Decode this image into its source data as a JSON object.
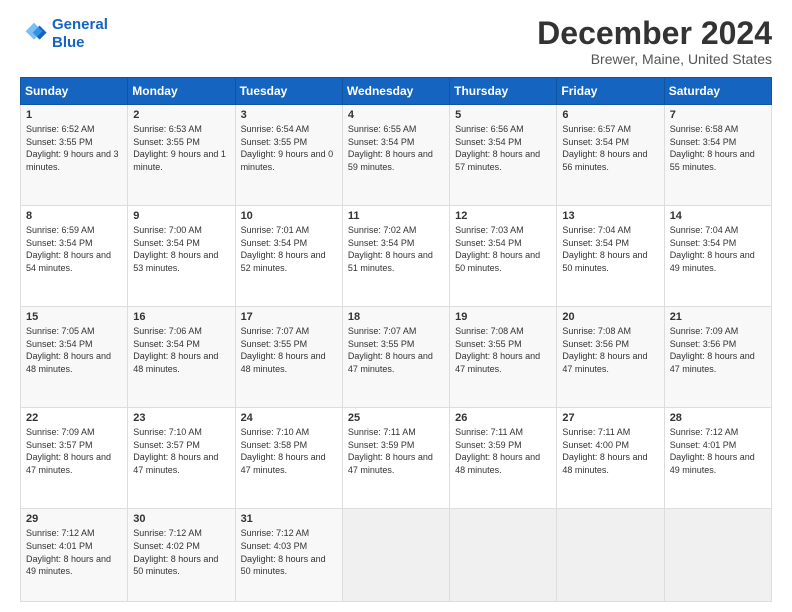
{
  "header": {
    "logo_line1": "General",
    "logo_line2": "Blue",
    "title": "December 2024",
    "subtitle": "Brewer, Maine, United States"
  },
  "days_of_week": [
    "Sunday",
    "Monday",
    "Tuesday",
    "Wednesday",
    "Thursday",
    "Friday",
    "Saturday"
  ],
  "weeks": [
    [
      {
        "day": "1",
        "sunrise": "6:52 AM",
        "sunset": "3:55 PM",
        "daylight": "9 hours and 3 minutes."
      },
      {
        "day": "2",
        "sunrise": "6:53 AM",
        "sunset": "3:55 PM",
        "daylight": "9 hours and 1 minute."
      },
      {
        "day": "3",
        "sunrise": "6:54 AM",
        "sunset": "3:55 PM",
        "daylight": "9 hours and 0 minutes."
      },
      {
        "day": "4",
        "sunrise": "6:55 AM",
        "sunset": "3:54 PM",
        "daylight": "8 hours and 59 minutes."
      },
      {
        "day": "5",
        "sunrise": "6:56 AM",
        "sunset": "3:54 PM",
        "daylight": "8 hours and 57 minutes."
      },
      {
        "day": "6",
        "sunrise": "6:57 AM",
        "sunset": "3:54 PM",
        "daylight": "8 hours and 56 minutes."
      },
      {
        "day": "7",
        "sunrise": "6:58 AM",
        "sunset": "3:54 PM",
        "daylight": "8 hours and 55 minutes."
      }
    ],
    [
      {
        "day": "8",
        "sunrise": "6:59 AM",
        "sunset": "3:54 PM",
        "daylight": "8 hours and 54 minutes."
      },
      {
        "day": "9",
        "sunrise": "7:00 AM",
        "sunset": "3:54 PM",
        "daylight": "8 hours and 53 minutes."
      },
      {
        "day": "10",
        "sunrise": "7:01 AM",
        "sunset": "3:54 PM",
        "daylight": "8 hours and 52 minutes."
      },
      {
        "day": "11",
        "sunrise": "7:02 AM",
        "sunset": "3:54 PM",
        "daylight": "8 hours and 51 minutes."
      },
      {
        "day": "12",
        "sunrise": "7:03 AM",
        "sunset": "3:54 PM",
        "daylight": "8 hours and 50 minutes."
      },
      {
        "day": "13",
        "sunrise": "7:04 AM",
        "sunset": "3:54 PM",
        "daylight": "8 hours and 50 minutes."
      },
      {
        "day": "14",
        "sunrise": "7:04 AM",
        "sunset": "3:54 PM",
        "daylight": "8 hours and 49 minutes."
      }
    ],
    [
      {
        "day": "15",
        "sunrise": "7:05 AM",
        "sunset": "3:54 PM",
        "daylight": "8 hours and 48 minutes."
      },
      {
        "day": "16",
        "sunrise": "7:06 AM",
        "sunset": "3:54 PM",
        "daylight": "8 hours and 48 minutes."
      },
      {
        "day": "17",
        "sunrise": "7:07 AM",
        "sunset": "3:55 PM",
        "daylight": "8 hours and 48 minutes."
      },
      {
        "day": "18",
        "sunrise": "7:07 AM",
        "sunset": "3:55 PM",
        "daylight": "8 hours and 47 minutes."
      },
      {
        "day": "19",
        "sunrise": "7:08 AM",
        "sunset": "3:55 PM",
        "daylight": "8 hours and 47 minutes."
      },
      {
        "day": "20",
        "sunrise": "7:08 AM",
        "sunset": "3:56 PM",
        "daylight": "8 hours and 47 minutes."
      },
      {
        "day": "21",
        "sunrise": "7:09 AM",
        "sunset": "3:56 PM",
        "daylight": "8 hours and 47 minutes."
      }
    ],
    [
      {
        "day": "22",
        "sunrise": "7:09 AM",
        "sunset": "3:57 PM",
        "daylight": "8 hours and 47 minutes."
      },
      {
        "day": "23",
        "sunrise": "7:10 AM",
        "sunset": "3:57 PM",
        "daylight": "8 hours and 47 minutes."
      },
      {
        "day": "24",
        "sunrise": "7:10 AM",
        "sunset": "3:58 PM",
        "daylight": "8 hours and 47 minutes."
      },
      {
        "day": "25",
        "sunrise": "7:11 AM",
        "sunset": "3:59 PM",
        "daylight": "8 hours and 47 minutes."
      },
      {
        "day": "26",
        "sunrise": "7:11 AM",
        "sunset": "3:59 PM",
        "daylight": "8 hours and 48 minutes."
      },
      {
        "day": "27",
        "sunrise": "7:11 AM",
        "sunset": "4:00 PM",
        "daylight": "8 hours and 48 minutes."
      },
      {
        "day": "28",
        "sunrise": "7:12 AM",
        "sunset": "4:01 PM",
        "daylight": "8 hours and 49 minutes."
      }
    ],
    [
      {
        "day": "29",
        "sunrise": "7:12 AM",
        "sunset": "4:01 PM",
        "daylight": "8 hours and 49 minutes."
      },
      {
        "day": "30",
        "sunrise": "7:12 AM",
        "sunset": "4:02 PM",
        "daylight": "8 hours and 50 minutes."
      },
      {
        "day": "31",
        "sunrise": "7:12 AM",
        "sunset": "4:03 PM",
        "daylight": "8 hours and 50 minutes."
      },
      null,
      null,
      null,
      null
    ]
  ]
}
